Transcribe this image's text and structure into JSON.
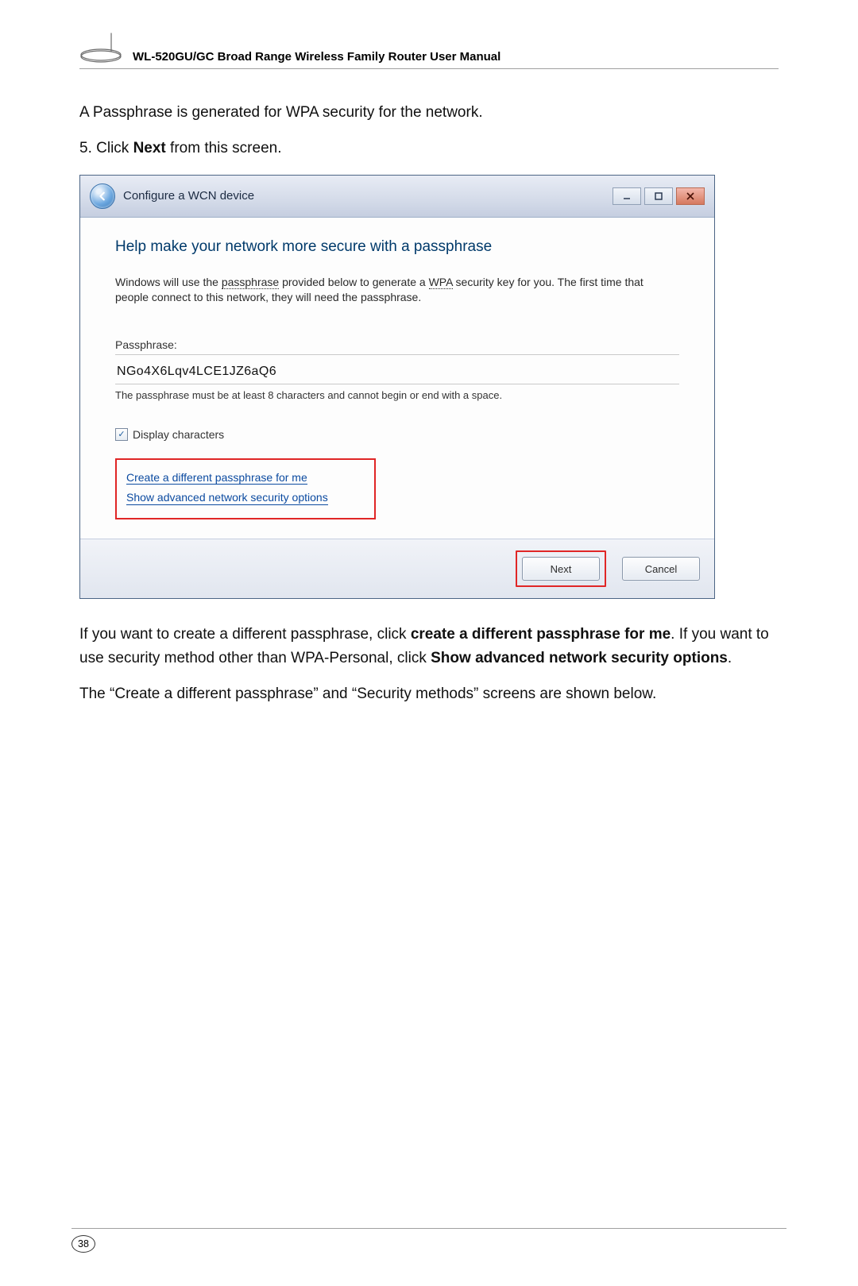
{
  "header": {
    "title": "WL-520GU/GC Broad Range Wireless Family Router User Manual"
  },
  "body": {
    "intro": "A Passphrase is generated for WPA security for the network.",
    "step5_pre": "5. Click ",
    "step5_bold": "Next",
    "step5_post": " from this screen.",
    "para2_a": "If you want to create a different passphrase, click ",
    "para2_b": "create a different passphrase for me",
    "para2_c": ". If you want to use security method other than WPA-Personal, click ",
    "para2_d": "Show advanced network security options",
    "para2_e": ".",
    "para3": "The “Create a different passphrase” and “Security methods” screens are shown below."
  },
  "dialog": {
    "titlebar": "Configure a WCN device",
    "heading": "Help make your network more secure with a passphrase",
    "desc_a": "Windows will use the ",
    "desc_b": "passphrase",
    "desc_c": " provided below to generate a ",
    "desc_d": "WPA",
    "desc_e": " security key for you. The first time that people connect to this network, they will need the passphrase.",
    "field_label": "Passphrase:",
    "field_value": "NGo4X6Lqv4LCE1JZ6aQ6",
    "field_hint": "The passphrase must be at least 8 characters and cannot begin or end with a space.",
    "checkbox_label": "Display characters",
    "link1": "Create a different passphrase for me",
    "link2": "Show advanced network security options",
    "btn_next": "Next",
    "btn_cancel": "Cancel"
  },
  "page_number": "38"
}
